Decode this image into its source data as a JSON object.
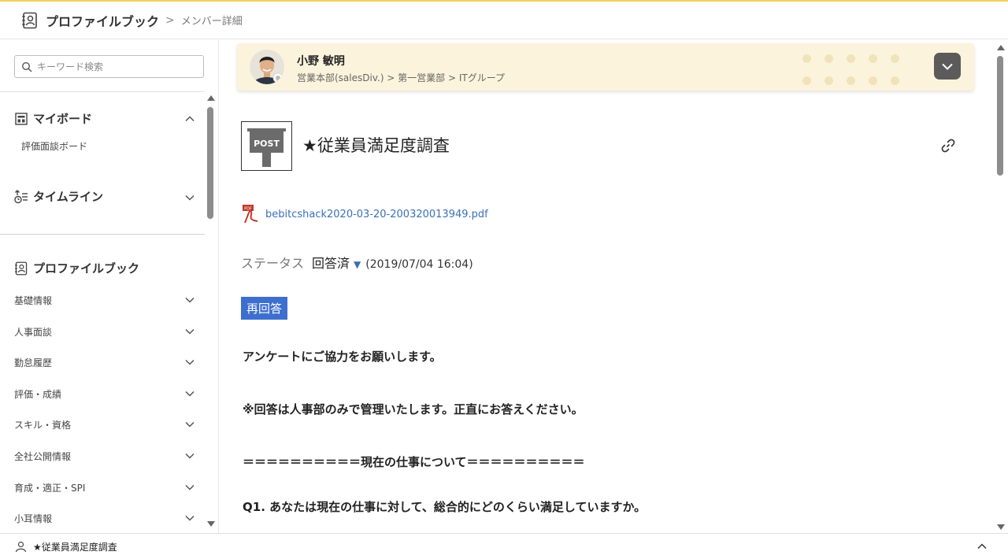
{
  "header": {
    "app_title": "プロファイルブック",
    "separator": ">",
    "breadcrumb": "メンバー詳細",
    "accent_color": "#f2d25a"
  },
  "sidebar": {
    "search": {
      "placeholder": "キーワード検索"
    },
    "myboard": {
      "title": "マイボード",
      "items": [
        "評価面談ボード"
      ]
    },
    "timeline": {
      "title": "タイムライン"
    },
    "profilebook": {
      "title": "プロファイルブック",
      "items": [
        "基礎情報",
        "人事面談",
        "勤怠履歴",
        "評価・成績",
        "スキル・資格",
        "全社公開情報",
        "育成・適正・SPI",
        "小耳情報"
      ]
    }
  },
  "profile": {
    "name": "小野 敏明",
    "department": "営業本部(salesDiv.) > 第一営業部 > ITグループ",
    "card_color": "#fbf3dc"
  },
  "document": {
    "post_icon_label": "POST",
    "title": "★従業員満足度調査",
    "attachment": "bebitcshack2020-03-20-200320013949.pdf",
    "status_label": "ステータス",
    "status_value": "回答済",
    "status_caret": "▼",
    "status_time": "(2019/07/04 16:04)",
    "reanswer_button": "再回答",
    "button_color": "#3d6fcf",
    "lines": [
      "アンケートにご協力をお願いします。",
      "※回答は人事部のみで管理いたします。正直にお答えください。",
      "＝＝＝＝＝＝＝＝＝＝現在の仕事について＝＝＝＝＝＝＝＝＝＝",
      "Q1.  あなたは現在の仕事に対して、総合的にどのくらい満足していますか。"
    ]
  },
  "bottom_bar": {
    "title": "★従業員満足度調査"
  },
  "icons": {
    "header": "profile-book-icon",
    "search": "search-icon",
    "myboard": "board-icon",
    "timeline": "timeline-icon",
    "profilebook": "profile-book-icon",
    "attachment": "pdf-icon",
    "link": "link-icon",
    "bottom": "user-icon"
  }
}
